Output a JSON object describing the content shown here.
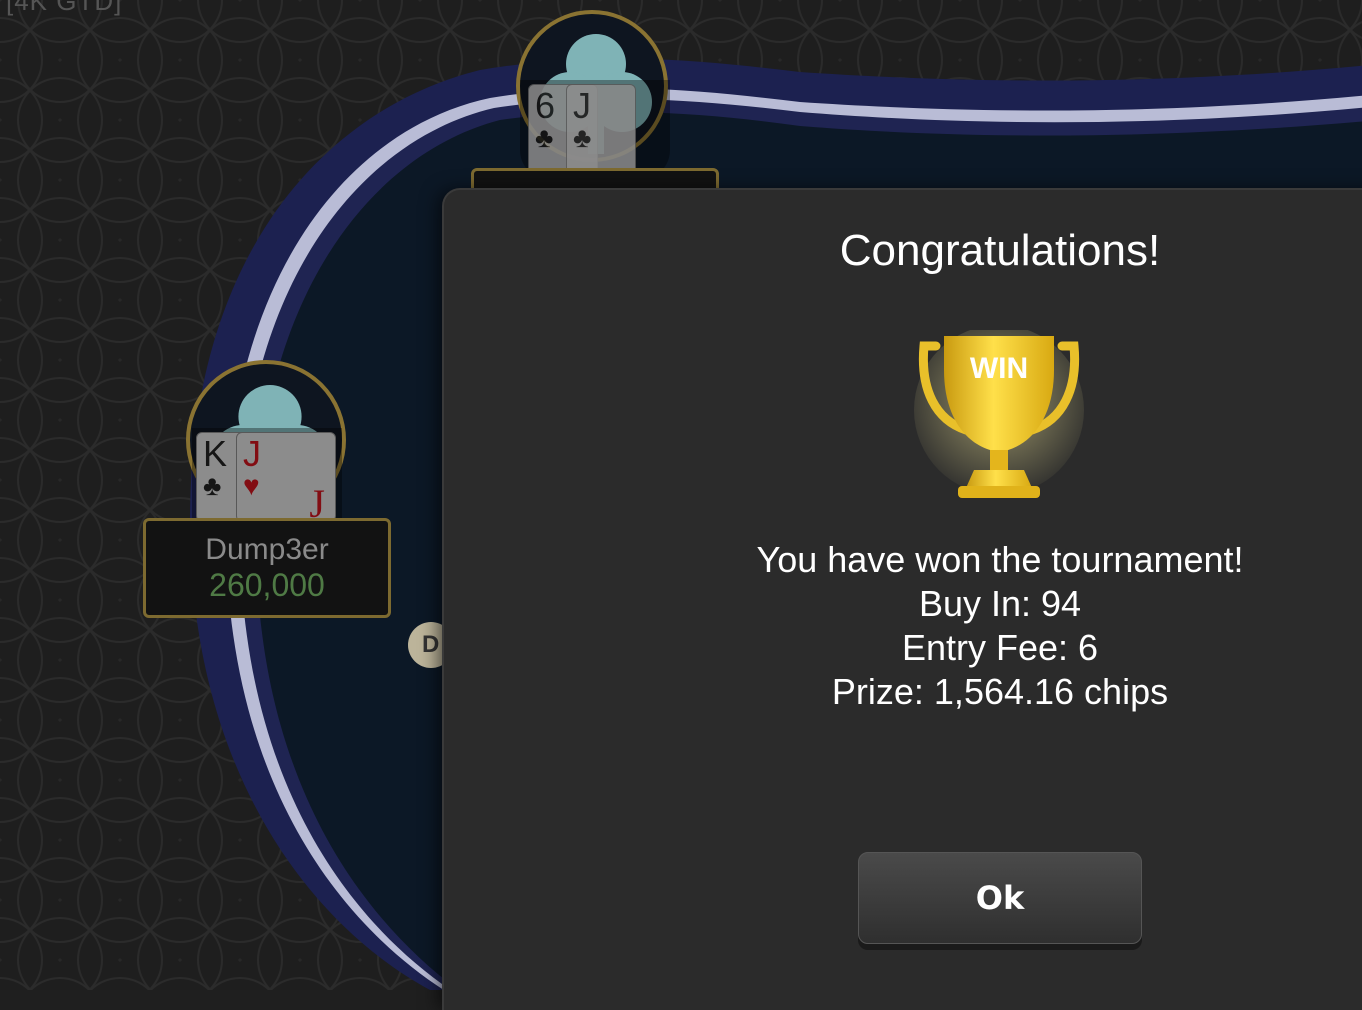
{
  "table": {
    "title": "[4K GTD]",
    "dealer_button": "D"
  },
  "seats": [
    {
      "id": "top",
      "name": "",
      "cards": [
        {
          "rank": "6",
          "suit": "♣",
          "color": "black"
        },
        {
          "rank": "J",
          "suit": "♣",
          "color": "black"
        }
      ]
    },
    {
      "id": "left",
      "name": "Dump3er",
      "chips": "260,000",
      "cards": [
        {
          "rank": "K",
          "suit": "♣",
          "color": "black"
        },
        {
          "rank": "J",
          "suit": "♥",
          "color": "red"
        }
      ]
    }
  ],
  "modal": {
    "title": "Congratulations!",
    "trophy_label": "WIN",
    "trophy_icon": "trophy-icon",
    "lines": [
      "You have won the tournament!",
      "Buy In: 94",
      "Entry Fee: 6",
      "Prize: 1,564.16 chips"
    ],
    "ok_label": "Ok"
  },
  "colors": {
    "table_rail": "#23275a",
    "felt": "#0d1a2a",
    "gold": "#8a7332",
    "chips_green": "#4f7a45",
    "trophy_gold": "#f2cf2a"
  }
}
